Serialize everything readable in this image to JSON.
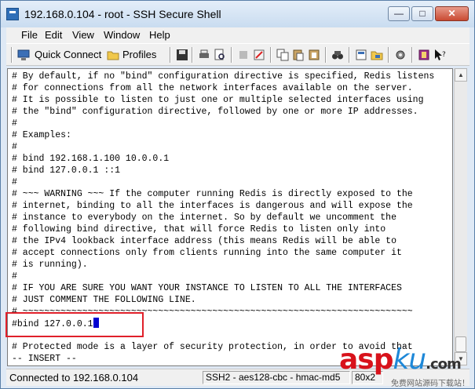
{
  "window": {
    "title": "192.168.0.104 - root - SSH Secure Shell"
  },
  "menu": [
    "File",
    "Edit",
    "View",
    "Window",
    "Help"
  ],
  "toolbar": {
    "quick_connect": "Quick Connect",
    "profiles": "Profiles",
    "icons": [
      "save-icon",
      "print-icon",
      "print-preview-icon",
      "disconnect-icon",
      "settings-icon",
      "copy-icon",
      "paste-icon",
      "paste-selection-icon",
      "find-icon",
      "new-file-transfer-icon",
      "new-terminal-icon",
      "help-icon",
      "context-help-icon"
    ]
  },
  "terminal": {
    "lines": [
      "# By default, if no \"bind\" configuration directive is specified, Redis listens",
      "# for connections from all the network interfaces available on the server.",
      "# It is possible to listen to just one or multiple selected interfaces using",
      "# the \"bind\" configuration directive, followed by one or more IP addresses.",
      "#",
      "# Examples:",
      "#",
      "# bind 192.168.1.100 10.0.0.1",
      "# bind 127.0.0.1 ::1",
      "#",
      "# ~~~ WARNING ~~~ If the computer running Redis is directly exposed to the",
      "# internet, binding to all the interfaces is dangerous and will expose the",
      "# instance to everybody on the internet. So by default we uncomment the",
      "# following bind directive, that will force Redis to listen only into",
      "# the IPv4 lookback interface address (this means Redis will be able to",
      "# accept connections only from clients running into the same computer it",
      "# is running).",
      "#",
      "# IF YOU ARE SURE YOU WANT YOUR INSTANCE TO LISTEN TO ALL THE INTERFACES",
      "# JUST COMMENT THE FOLLOWING LINE.",
      "# ~~~~~~~~~~~~~~~~~~~~~~~~~~~~~~~~~~~~~~~~~~~~~~~~~~~~~~~~~~~~~~~~~~~~~~~~",
      "#bind 127.0.0.1",
      "",
      "# Protected mode is a layer of security protection, in order to avoid that",
      "-- INSERT --"
    ],
    "cursor_line": 21
  },
  "status": {
    "connection": "Connected to 192.168.0.104",
    "cipher": "SSH2 - aes128-cbc - hmac-md5",
    "size": "80x2"
  },
  "watermark": {
    "main": "asp",
    "ku": "ku",
    "net": ".com",
    "sub": "免费网站源码下载站！"
  }
}
